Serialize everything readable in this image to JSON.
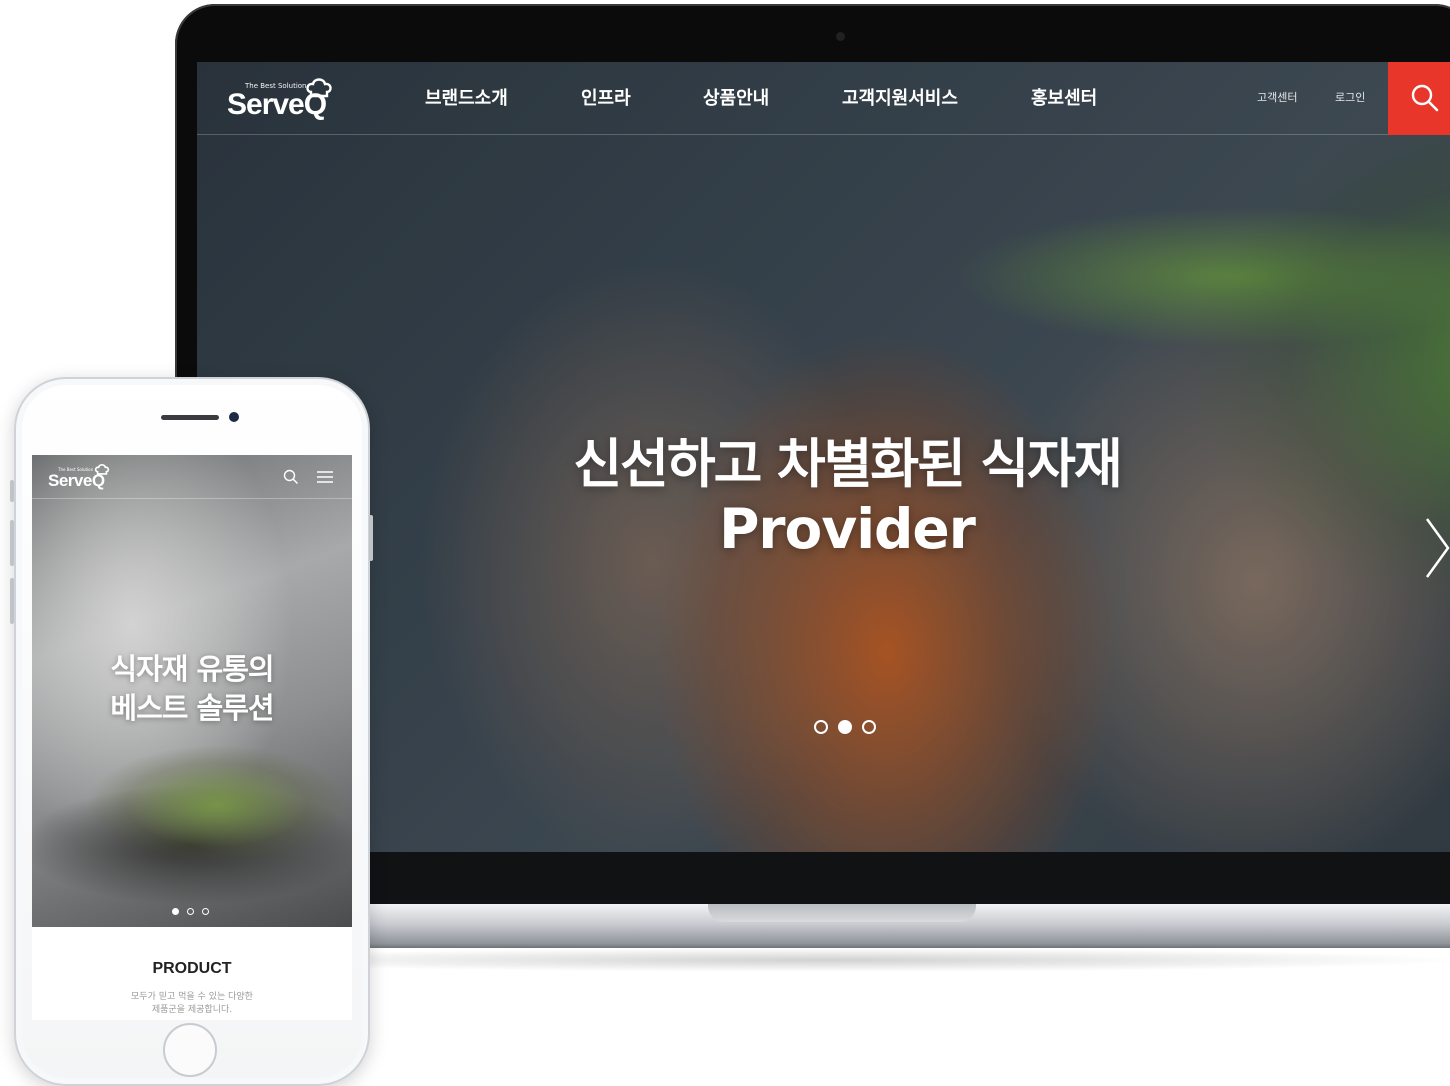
{
  "desktop": {
    "logo": {
      "tagline": "The Best Solution",
      "wordmark": "ServeQ"
    },
    "nav": {
      "items": [
        {
          "label": "브랜드소개"
        },
        {
          "label": "인프라"
        },
        {
          "label": "상품안내"
        },
        {
          "label": "고객지원서비스"
        },
        {
          "label": "홍보센터"
        }
      ],
      "customer_center": "고객센터",
      "login": "로그인",
      "search_icon": "search-icon"
    },
    "hero": {
      "title": "신선하고 차별화된 식자재",
      "subtitle": "Provider",
      "slide_count": 3,
      "active_slide": 2
    },
    "colors": {
      "accent": "#e8372a",
      "text": "#ffffff"
    }
  },
  "mobile": {
    "logo": {
      "tagline": "The Best Solution",
      "wordmark": "ServeQ"
    },
    "icons": [
      "search-icon",
      "menu-icon"
    ],
    "hero": {
      "title_line1": "식자재 유통의",
      "title_line2": "베스트 솔루션",
      "slide_count": 3,
      "active_slide": 1
    },
    "product": {
      "heading": "PRODUCT",
      "desc_line1": "모두가 믿고 먹을 수 있는 다양한",
      "desc_line2": "제품군을 제공합니다."
    }
  }
}
